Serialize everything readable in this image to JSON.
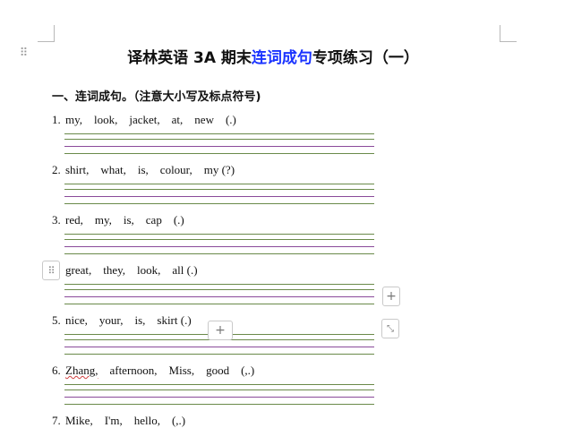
{
  "document": {
    "title_pre": "译林英语 3A 期末",
    "title_highlight": "连词成句",
    "title_post": "专项练习（一）",
    "section_heading": "一、连词成句。（注意大小写及标点符号)",
    "questions": [
      {
        "num": "1.",
        "text": "my,    look,    jacket,    at,    new    (.)"
      },
      {
        "num": "2.",
        "text": "shirt,    what,    is,    colour,    my (?)"
      },
      {
        "num": "3.",
        "text": "red,    my,    is,    cap    (.)"
      },
      {
        "num": "",
        "text": "great,    they,    look,    all (.)"
      },
      {
        "num": "5.",
        "text": "nice,    your,    is,    skirt (.)"
      },
      {
        "num": "6.",
        "first_word": "Zhang,",
        "rest": "    afternoon,    Miss,    good    (,.)"
      },
      {
        "num": "7.",
        "text": "Mike,    I'm,    hello,    (,.)"
      }
    ]
  },
  "controls": {
    "drag_icon": "⠿",
    "row_handle_icon": "⠿",
    "plus_icon": "+",
    "resize_icon": "⤡"
  },
  "colors": {
    "title_highlight": "#1a33ff",
    "line_green": "#6a8a4a",
    "line_purple": "#8a4a9a"
  }
}
